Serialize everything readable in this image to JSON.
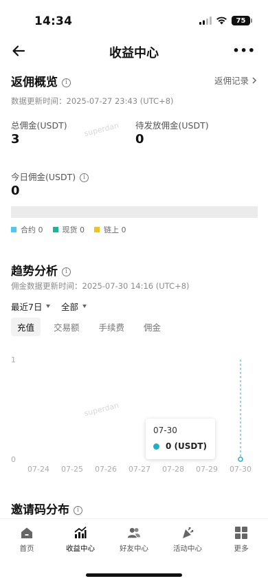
{
  "status_bar": {
    "time": "14:34",
    "battery": "75"
  },
  "header": {
    "title": "收益中心",
    "more": "•••"
  },
  "overview": {
    "title": "返佣概览",
    "records_link": "返佣记录",
    "updated": "数据更新时间：2025-07-27 23:43 (UTC+8)",
    "total_label": "总佣金(USDT)",
    "total_value": "3",
    "pending_label": "待发放佣金(USDT)",
    "pending_value": "0",
    "today_label": "今日佣金(USDT)",
    "today_value": "0",
    "watermark": "superdan",
    "legend": [
      {
        "label": "合约 0",
        "color": "#4dc9ef"
      },
      {
        "label": "现货 0",
        "color": "#1db39b"
      },
      {
        "label": "链上 0",
        "color": "#f4c01b"
      }
    ]
  },
  "trend": {
    "title": "趋势分析",
    "updated": "佣金数据更新时间：2025-07-30 14:16 (UTC+8)",
    "range_select": "最近7日",
    "type_select": "全部",
    "tabs": [
      {
        "label": "充值",
        "active": true
      },
      {
        "label": "交易额",
        "active": false
      },
      {
        "label": "手续费",
        "active": false
      },
      {
        "label": "佣金",
        "active": false
      }
    ],
    "watermark": "superdan",
    "tooltip": {
      "date": "07-30",
      "value": "0 (USDT)"
    }
  },
  "chart_data": {
    "type": "line",
    "x": [
      "07-24",
      "07-25",
      "07-26",
      "07-27",
      "07-28",
      "07-29",
      "07-30"
    ],
    "series": [
      {
        "values": [
          0,
          0,
          0,
          0,
          0,
          0,
          0
        ],
        "color": "#1bb0c8"
      }
    ],
    "yticks": [
      "1",
      "0"
    ],
    "ylim": [
      0,
      1
    ],
    "grid": false,
    "highlighted_index": 6
  },
  "invite": {
    "title": "邀请码分布"
  },
  "bottom_nav": [
    {
      "label": "首页",
      "icon": "home-icon",
      "active": false
    },
    {
      "label": "收益中心",
      "icon": "earnings-chart-icon",
      "active": true
    },
    {
      "label": "好友中心",
      "icon": "friends-icon",
      "active": false
    },
    {
      "label": "活动中心",
      "icon": "party-popper-icon",
      "active": false
    },
    {
      "label": "更多",
      "icon": "grid-more-icon",
      "active": false
    }
  ]
}
